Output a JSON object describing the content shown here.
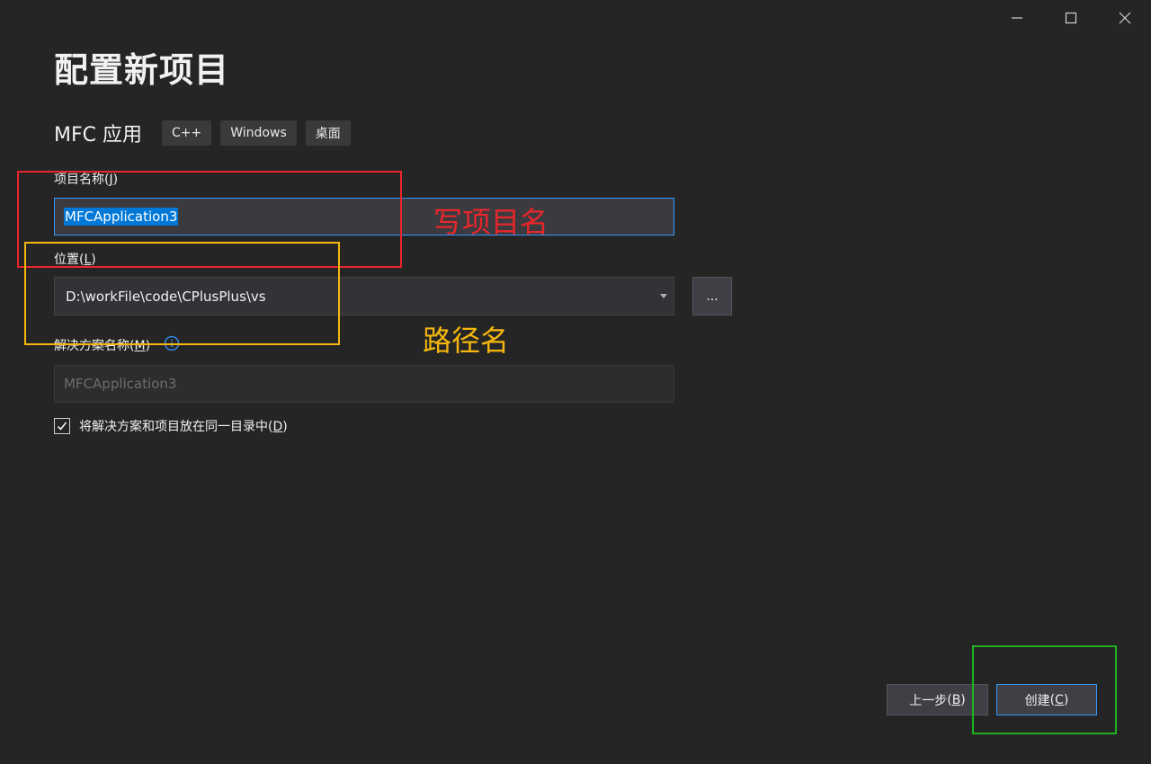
{
  "window": {
    "controls": {
      "minimize_icon": "minimize-icon",
      "maximize_icon": "maximize-icon",
      "close_icon": "close-icon"
    }
  },
  "header": {
    "title": "配置新项目",
    "template_name": "MFC 应用",
    "tags": [
      "C++",
      "Windows",
      "桌面"
    ]
  },
  "form": {
    "project_name": {
      "label": "项目名称",
      "accelerator": "J",
      "value": "MFCApplication3"
    },
    "location": {
      "label": "位置",
      "accelerator": "L",
      "value": "D:\\workFile\\code\\CPlusPlus\\vs",
      "browse_label": "..."
    },
    "solution_name": {
      "label": "解决方案名称",
      "accelerator": "M",
      "placeholder": "MFCApplication3",
      "info_icon": "info-icon"
    },
    "same_directory": {
      "checked": true,
      "label": "将解决方案和项目放在同一目录中",
      "accelerator": "D"
    }
  },
  "footer": {
    "back": {
      "label": "上一步",
      "accelerator": "B"
    },
    "create": {
      "label": "创建",
      "accelerator": "C"
    }
  },
  "annotations": {
    "project_name_note": "写项目名",
    "location_note": "路径名",
    "colors": {
      "red": "#e8262b",
      "yellow": "#f5b70e",
      "green": "#1fb21f"
    }
  },
  "colors": {
    "background": "#252526",
    "accent": "#3399ff",
    "selection": "#0078d7"
  }
}
